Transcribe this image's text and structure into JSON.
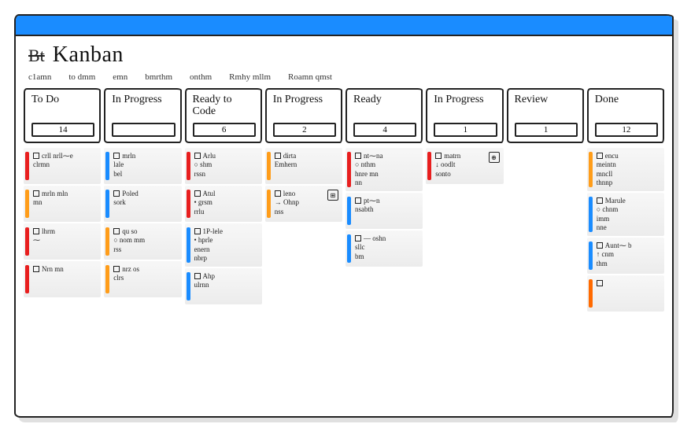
{
  "header": {
    "struck_label": "Bt",
    "title": "Kanban",
    "crumbs": [
      "c1amn",
      "to dmm",
      "emn",
      "bmrthm",
      "onthm",
      "Rmhy mllm",
      "Roamn qmst"
    ]
  },
  "columns": [
    {
      "title": "To Do",
      "count": "14",
      "cards": [
        {
          "stripe": "red",
          "text": "crll nrll⁓e\nclrmn"
        },
        {
          "stripe": "orange",
          "text": "mrln mln\nmn"
        },
        {
          "stripe": "red",
          "text": "lhrm\n⁓"
        },
        {
          "stripe": "red",
          "text": "Nrn mn"
        }
      ]
    },
    {
      "title": "In Progress",
      "count": "",
      "cards": [
        {
          "stripe": "blue",
          "text": "mrln\nlale\nbel"
        },
        {
          "stripe": "blue",
          "text": "Poled\nsork"
        },
        {
          "stripe": "orange",
          "text": "qu so\n○ nom mm\nrss"
        },
        {
          "stripe": "orange",
          "text": "nrz os\nclrs"
        }
      ]
    },
    {
      "title": "Ready to Code",
      "count": "6",
      "cards": [
        {
          "stripe": "red",
          "text": "Arlu\n○ shm\nrssn"
        },
        {
          "stripe": "red",
          "text": "Atul\n• grsm\nrrlu"
        },
        {
          "stripe": "blue",
          "text": "1P-lele\n• hprle\nenern\nnbrp"
        },
        {
          "stripe": "blue",
          "text": "Ahp\nulrnn"
        }
      ]
    },
    {
      "title": "In Progress",
      "count": "2",
      "cards": [
        {
          "stripe": "orange",
          "text": "dirta\nEmhern"
        },
        {
          "stripe": "orange",
          "text": "leno\n→ Ohnp\nnss",
          "badge": "⊞"
        }
      ]
    },
    {
      "title": "Ready",
      "count": "4",
      "cards": [
        {
          "stripe": "red",
          "text": "nt⁓na\n○ nthm\nhnre mn\nnn"
        },
        {
          "stripe": "blue",
          "text": "pt⁓n\nnsabth"
        },
        {
          "stripe": "blue",
          "text": "— oshn\nsllc\nbm"
        }
      ]
    },
    {
      "title": "In Progress",
      "count": "1",
      "cards": [
        {
          "stripe": "red",
          "text": "matrn\n↓ oodlt\nsonto",
          "badge": "⊕"
        }
      ]
    },
    {
      "title": "Review",
      "count": "1",
      "cards": []
    },
    {
      "title": "Done",
      "count": "12",
      "cards": [
        {
          "stripe": "orange",
          "text": "encu\nmeintn\nmncll\nthnnp"
        },
        {
          "stripe": "blue",
          "text": "Marule\n○ chnm\nimm\nnne"
        },
        {
          "stripe": "blue",
          "text": "Aunt⁓ b\n↑ cnm\nthm"
        },
        {
          "stripe": "darkorange",
          "text": ""
        }
      ]
    }
  ]
}
